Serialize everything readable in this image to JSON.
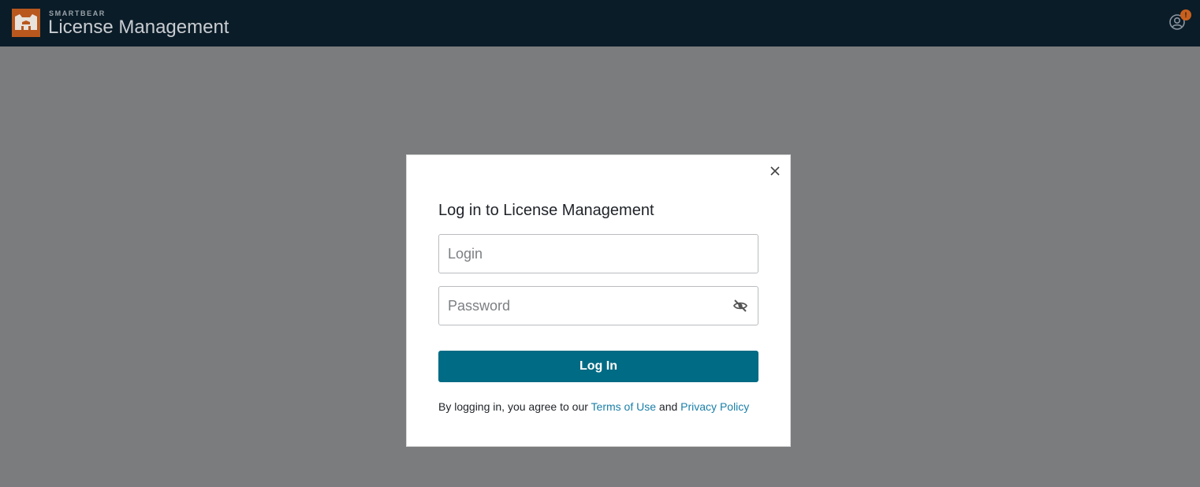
{
  "header": {
    "brand_small": "SMARTBEAR",
    "brand_title": "License Management",
    "notification_count": "!",
    "colors": {
      "bar": "#0a1c28",
      "logo": "#b8581e",
      "badge": "#c9601d"
    },
    "icons": {
      "logo": "bear-logo-icon",
      "user": "user-account-icon"
    }
  },
  "modal": {
    "title": "Log in to License Management",
    "login": {
      "placeholder": "Login",
      "value": ""
    },
    "password": {
      "placeholder": "Password",
      "value": ""
    },
    "submit_label": "Log In",
    "legal": {
      "prefix": "By logging in, you agree to our ",
      "terms_label": "Terms of Use",
      "middle": " and ",
      "privacy_label": "Privacy Policy"
    },
    "colors": {
      "primary": "#006b84",
      "link": "#1a7fa8"
    },
    "icons": {
      "close": "close-icon",
      "reveal": "eye-slash-icon"
    }
  }
}
